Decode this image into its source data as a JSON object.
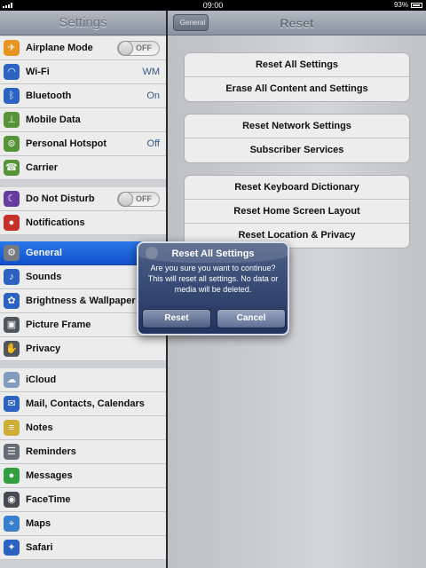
{
  "statusbar": {
    "time": "09:00",
    "battery": "93%"
  },
  "sidebar": {
    "title": "Settings",
    "items": [
      {
        "label": "Airplane Mode",
        "toggle": "OFF",
        "icon": "airplane-icon",
        "color": "#f29b22"
      },
      {
        "label": "Wi-Fi",
        "value": "WM",
        "icon": "wifi-icon",
        "color": "#2e66c9"
      },
      {
        "label": "Bluetooth",
        "value": "On",
        "icon": "bluetooth-icon",
        "color": "#2e66c9"
      },
      {
        "label": "Mobile Data",
        "icon": "mobile-data-icon",
        "color": "#5b9a3c"
      },
      {
        "label": "Personal Hotspot",
        "value": "Off",
        "icon": "hotspot-icon",
        "color": "#5b9a3c"
      },
      {
        "label": "Carrier",
        "icon": "phone-icon",
        "color": "#5b9a3c"
      },
      {
        "label": "Do Not Disturb",
        "toggle": "OFF",
        "icon": "moon-icon",
        "color": "#6b3fa8"
      },
      {
        "label": "Notifications",
        "icon": "notifications-icon",
        "color": "#d0312d"
      },
      {
        "label": "General",
        "icon": "gear-icon",
        "color": "#7b8088",
        "selected": true
      },
      {
        "label": "Sounds",
        "icon": "speaker-icon",
        "color": "#2e66c9"
      },
      {
        "label": "Brightness & Wallpaper",
        "icon": "flower-icon",
        "color": "#2e66c9"
      },
      {
        "label": "Picture Frame",
        "icon": "picture-frame-icon",
        "color": "#555a61"
      },
      {
        "label": "Privacy",
        "icon": "hand-icon",
        "color": "#555a61"
      },
      {
        "label": "iCloud",
        "icon": "cloud-icon",
        "color": "#8aa2c6"
      },
      {
        "label": "Mail, Contacts, Calendars",
        "icon": "mail-icon",
        "color": "#2e66c9"
      },
      {
        "label": "Notes",
        "icon": "notes-icon",
        "color": "#d6b73a"
      },
      {
        "label": "Reminders",
        "icon": "reminders-icon",
        "color": "#6d727a"
      },
      {
        "label": "Messages",
        "icon": "messages-icon",
        "color": "#35a542"
      },
      {
        "label": "FaceTime",
        "icon": "facetime-icon",
        "color": "#4a4e55"
      },
      {
        "label": "Maps",
        "icon": "maps-icon",
        "color": "#3c85d6"
      },
      {
        "label": "Safari",
        "icon": "safari-icon",
        "color": "#2e66c9"
      }
    ]
  },
  "detail": {
    "back_label": "General",
    "title": "Reset",
    "group1": [
      "Reset All Settings",
      "Erase All Content and Settings"
    ],
    "group2": [
      "Reset Network Settings",
      "Subscriber Services"
    ],
    "group3": [
      "Reset Keyboard Dictionary",
      "Reset Home Screen Layout",
      "Reset Location & Privacy"
    ]
  },
  "alert": {
    "title": "Reset All Settings",
    "message": "Are you sure you want to continue? This will reset all settings. No data or media will be deleted.",
    "reset_label": "Reset",
    "cancel_label": "Cancel"
  }
}
